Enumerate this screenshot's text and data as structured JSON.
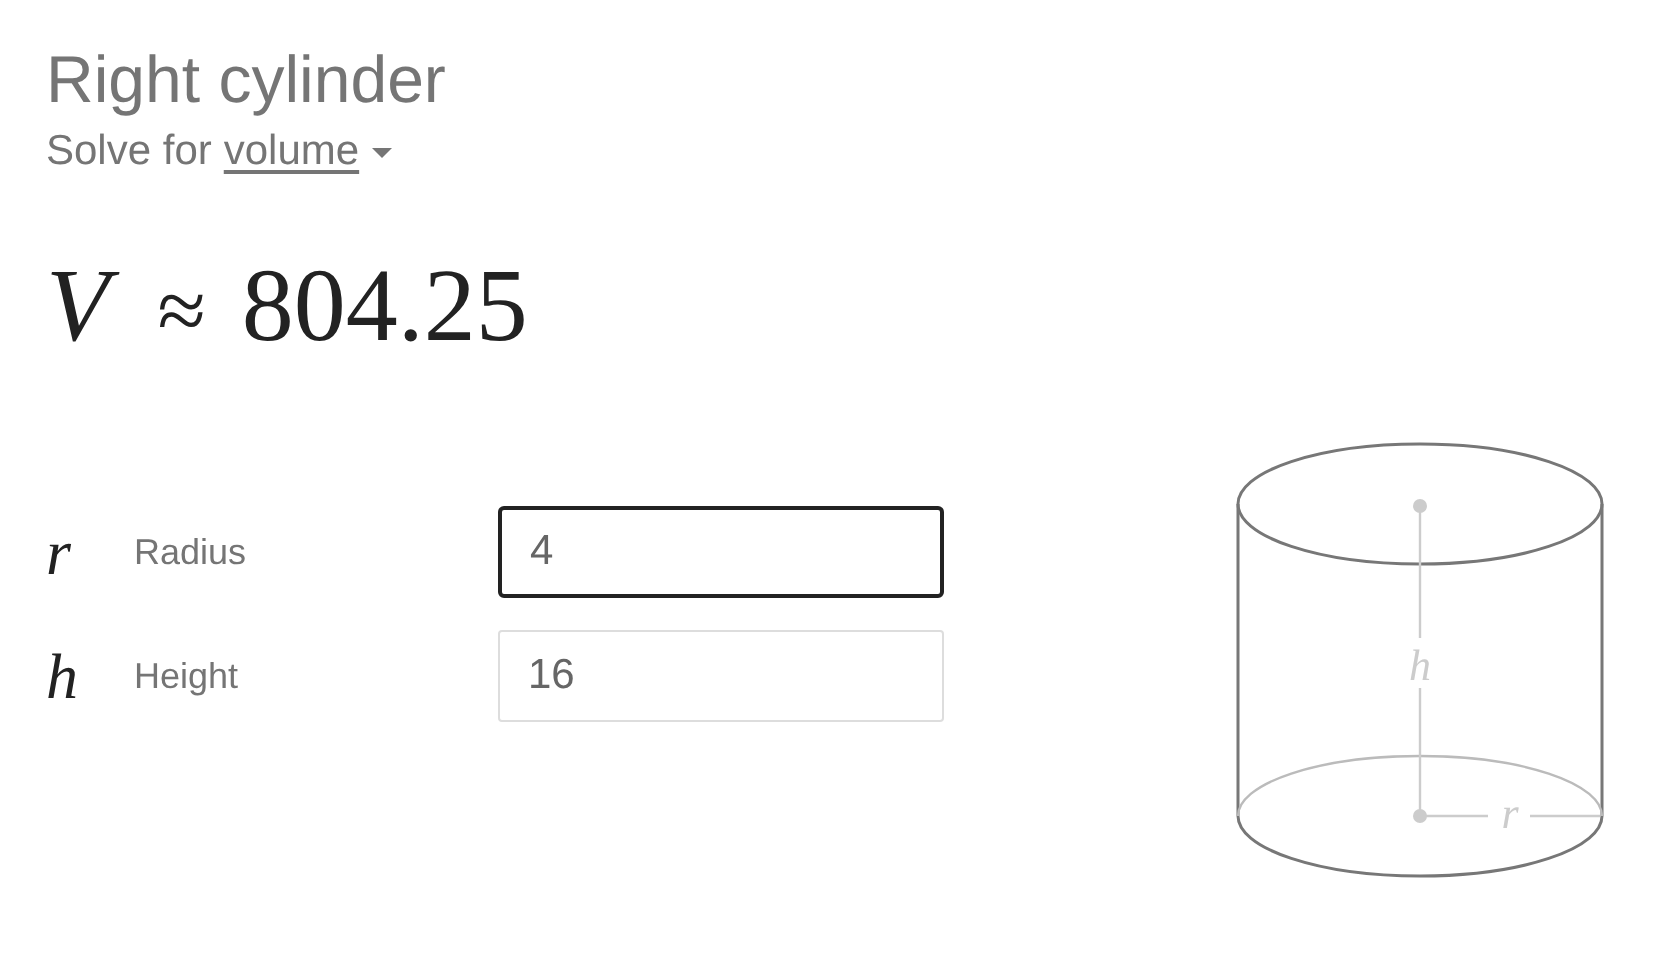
{
  "title": "Right cylinder",
  "solve_for": {
    "prefix": "Solve for",
    "option": "volume"
  },
  "result": {
    "symbol": "V",
    "relation": "≈",
    "value": "804.25"
  },
  "fields": [
    {
      "symbol": "r",
      "label": "Radius",
      "value": "4",
      "focused": true
    },
    {
      "symbol": "h",
      "label": "Height",
      "value": "16",
      "focused": false
    }
  ],
  "diagram": {
    "height_label": "h",
    "radius_label": "r"
  }
}
